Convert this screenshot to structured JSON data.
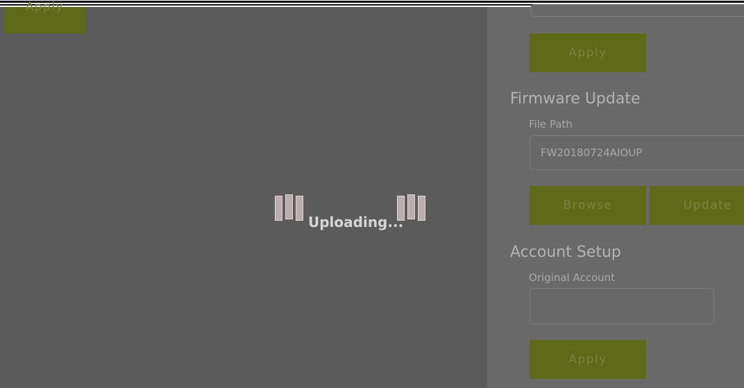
{
  "top_left": {
    "apply_label": "Apply"
  },
  "loader": {
    "text": "Uploading..."
  },
  "settings": {
    "first_section": {
      "apply_label": "Apply"
    },
    "firmware": {
      "title": "Firmware Update",
      "file_path_label": "File Path",
      "file_path_value": "FW20180724AIOUP",
      "browse_label": "Browse",
      "update_label": "Update"
    },
    "account": {
      "title": "Account Setup",
      "original_account_label": "Original Account",
      "original_account_value": "",
      "apply_label": "Apply"
    }
  },
  "colors": {
    "overlay": "#5b5b5b",
    "panel": "#696969",
    "button": "#5e6a18",
    "button_text": "#7a8340"
  }
}
